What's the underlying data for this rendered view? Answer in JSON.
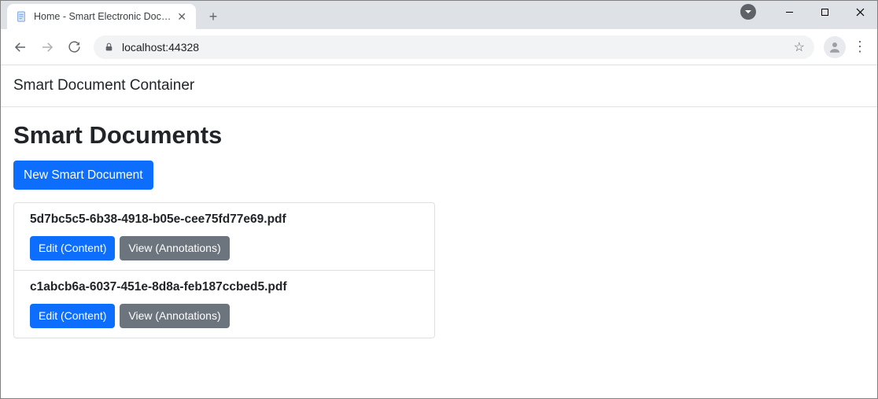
{
  "browser": {
    "tab_title": "Home - Smart Electronic Docume",
    "url_display": "localhost:44328"
  },
  "navbar": {
    "brand": "Smart Document Container"
  },
  "page": {
    "heading": "Smart Documents",
    "new_button_label": "New Smart Document"
  },
  "documents": [
    {
      "name": "5d7bc5c5-6b38-4918-b05e-cee75fd77e69.pdf",
      "edit_label": "Edit (Content)",
      "view_label": "View (Annotations)"
    },
    {
      "name": "c1abcb6a-6037-451e-8d8a-feb187ccbed5.pdf",
      "edit_label": "Edit (Content)",
      "view_label": "View (Annotations)"
    }
  ]
}
